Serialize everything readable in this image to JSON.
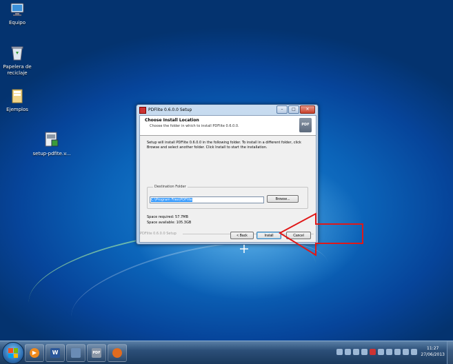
{
  "desktop_icons": [
    {
      "name": "computer",
      "label": "Equipo"
    },
    {
      "name": "recycle-bin",
      "label": "Papelera de reciclaje"
    },
    {
      "name": "folder",
      "label": "Ejemplos"
    },
    {
      "name": "setup-file",
      "label": "setup-pdfite.v..."
    }
  ],
  "window": {
    "title": "PDFlite 0.6.0.0 Setup",
    "controls": {
      "minimize": "–",
      "maximize": "□",
      "close": "✕"
    },
    "header_title": "Choose Install Location",
    "header_subtitle": "Choose the folder in which to install PDFlite 0.6.0.0.",
    "logo_text": "PDF",
    "description": "Setup will install PDFlite 0.6.0.0 in the following folder. To install in a different folder, click Browse and select another folder. Click Install to start the installation.",
    "destination_label": "Destination Folder",
    "destination_value": "C:\\Program Files\\PDFlite",
    "browse_label": "Browse...",
    "space_required": "Space required: 57.7MB",
    "space_available": "Space available: 105.3GB",
    "branding": "PDFlite 0.6.0.0 Setup",
    "back_label": "< Back",
    "install_label": "Install",
    "cancel_label": "Cancel"
  },
  "taskbar": {
    "pinned": [
      {
        "name": "explorer",
        "color": "#e8b84a",
        "glyph": ""
      },
      {
        "name": "media-player",
        "color": "#f08a1c",
        "glyph": "▶"
      },
      {
        "name": "word",
        "color": "#2b579a",
        "glyph": "W"
      },
      {
        "name": "setup",
        "color": "#6a8cb5",
        "glyph": ""
      },
      {
        "name": "pdf",
        "color": "#8a96a6",
        "glyph": "PDF"
      },
      {
        "name": "firefox",
        "color": "#e06b1f",
        "glyph": ""
      }
    ],
    "time": "11:27",
    "date": "27/06/2013"
  },
  "colors": {
    "accent_arrow": "#e01818",
    "selection": "#3399ff"
  }
}
